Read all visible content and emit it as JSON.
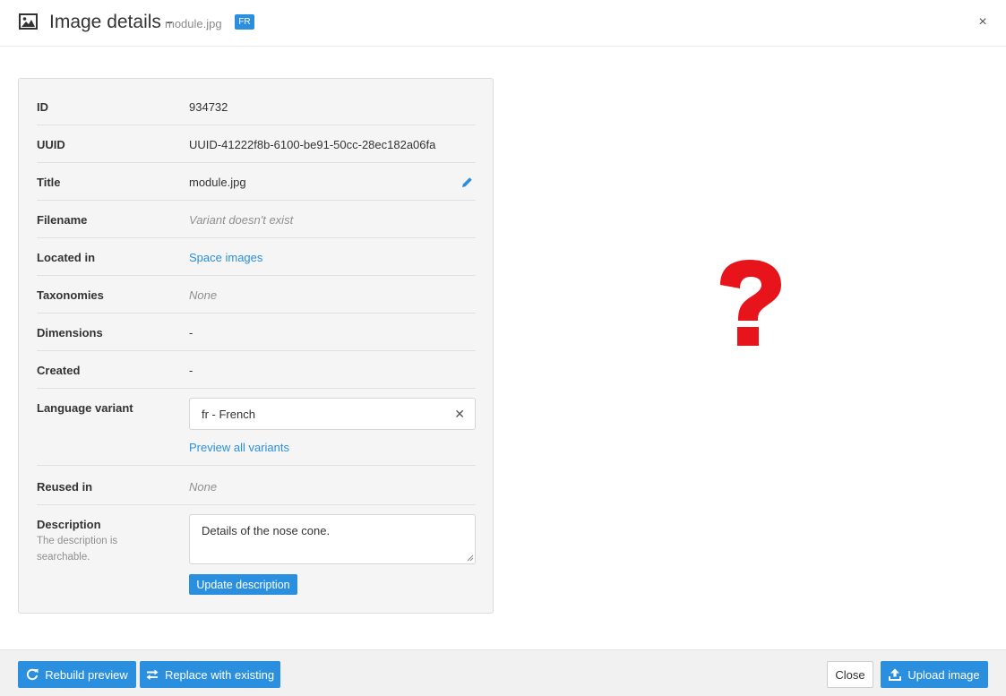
{
  "header": {
    "title": "Image details -",
    "filename": "module.jpg",
    "lang_badge": "FR",
    "close_glyph": "×"
  },
  "details": {
    "id": {
      "label": "ID",
      "value": "934732"
    },
    "uuid": {
      "label": "UUID",
      "value": "UUID-41222f8b-6100-be91-50cc-28ec182a06fa"
    },
    "title": {
      "label": "Title",
      "value": "module.jpg"
    },
    "filename": {
      "label": "Filename",
      "value": "Variant doesn't exist"
    },
    "located_in": {
      "label": "Located in",
      "value": "Space images"
    },
    "taxonomies": {
      "label": "Taxonomies",
      "value": "None"
    },
    "dimensions": {
      "label": "Dimensions",
      "value": "-"
    },
    "created": {
      "label": "Created",
      "value": "-"
    },
    "language_variant": {
      "label": "Language variant",
      "selected": "fr - French",
      "clear_glyph": "✕",
      "preview_link": "Preview all variants"
    },
    "reused_in": {
      "label": "Reused in",
      "value": "None"
    },
    "description": {
      "label": "Description",
      "hint": "The description is searchable.",
      "value": "Details of the nose cone.",
      "update_button": "Update description"
    }
  },
  "footer": {
    "rebuild_preview": "Rebuild preview",
    "replace_existing": "Replace with existing",
    "close": "Close",
    "upload_image": "Upload image"
  },
  "icons": {
    "header": "image-icon",
    "edit": "pencil-icon",
    "preview": "question-mark-icon",
    "rebuild": "refresh-icon",
    "replace": "swap-arrows-icon",
    "upload": "upload-icon"
  },
  "colors": {
    "accent": "#2b8fe0",
    "question_mark": "#e8141c",
    "panel_bg": "#f5f5f5"
  }
}
